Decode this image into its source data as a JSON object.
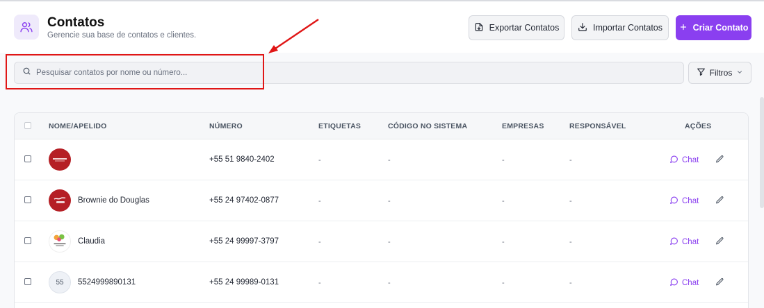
{
  "header": {
    "title": "Contatos",
    "subtitle": "Gerencie sua base de contatos e clientes.",
    "export_label": "Exportar Contatos",
    "import_label": "Importar Contatos",
    "create_label": "Criar Contato"
  },
  "search": {
    "placeholder": "Pesquisar contatos por nome ou número..."
  },
  "filters_label": "Filtros",
  "table": {
    "columns": [
      "NOME/APELIDO",
      "NÚMERO",
      "ETIQUETAS",
      "CÓDIGO NO SISTEMA",
      "EMPRESAS",
      "RESPONSÁVEL",
      "AÇÕES"
    ],
    "rows": [
      {
        "name": "",
        "avatar": "red-logo-icon",
        "avatar_text": "",
        "number": "+55 51 9840-2402",
        "tags": "-",
        "code": "-",
        "companies": "-",
        "owner": "-",
        "chat_label": "Chat"
      },
      {
        "name": "Brownie do Douglas",
        "avatar": "brownie-logo-icon",
        "avatar_text": "",
        "number": "+55 24 97402-0877",
        "tags": "-",
        "code": "-",
        "companies": "-",
        "owner": "-",
        "chat_label": "Chat"
      },
      {
        "name": "Claudia",
        "avatar": "flower-logo-icon",
        "avatar_text": "",
        "number": "+55 24 99997-3797",
        "tags": "-",
        "code": "-",
        "companies": "-",
        "owner": "-",
        "chat_label": "Chat"
      },
      {
        "name": "5524999890131",
        "avatar": "initials-avatar",
        "avatar_text": "55",
        "number": "+55 24 99989-0131",
        "tags": "-",
        "code": "-",
        "companies": "-",
        "owner": "-",
        "chat_label": "Chat"
      }
    ]
  },
  "colors": {
    "accent": "#8a3ff0",
    "annotation": "#e01616"
  }
}
